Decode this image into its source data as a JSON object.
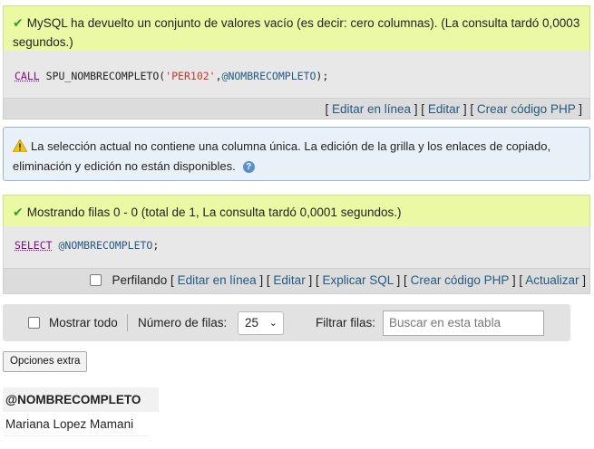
{
  "msg1": {
    "text": "MySQL ha devuelto un conjunto de valores vacío (es decir: cero columnas). (La consulta tardó 0,0003 segundos.)"
  },
  "sql1": {
    "kw": "CALL",
    "fn": "SPU_NOMBRECOMPLETO(",
    "str": "'PER102'",
    "comma": ",",
    "var": "@NOMBRECOMPLETO",
    "end": ");"
  },
  "actions1": {
    "edit_inline": "Editar en línea",
    "edit": "Editar",
    "php": "Crear código PHP"
  },
  "notice": {
    "text": "La selección actual no contiene una columna única. La edición de la grilla y los enlaces de copiado, eliminación y edición no están disponibles."
  },
  "msg2": {
    "text": "Mostrando filas 0 - 0 (total de 1, La consulta tardó 0,0001 segundos.)"
  },
  "sql2": {
    "kw": "SELECT",
    "var": "@NOMBRECOMPLETO",
    "end": ";"
  },
  "actions2": {
    "profiling": "Perfilando",
    "edit_inline": "Editar en línea",
    "edit": "Editar",
    "explain": "Explicar SQL",
    "php": "Crear código PHP",
    "refresh": "Actualizar"
  },
  "navbar": {
    "show_all": "Mostrar todo",
    "rows_label": "Número de filas:",
    "rows_value": "25",
    "filter_label": "Filtrar filas:",
    "search_placeholder": "Buscar en esta tabla"
  },
  "extra_options": "Opciones extra",
  "result": {
    "column": "@NOMBRECOMPLETO",
    "value": "Mariana Lopez Mamani"
  }
}
